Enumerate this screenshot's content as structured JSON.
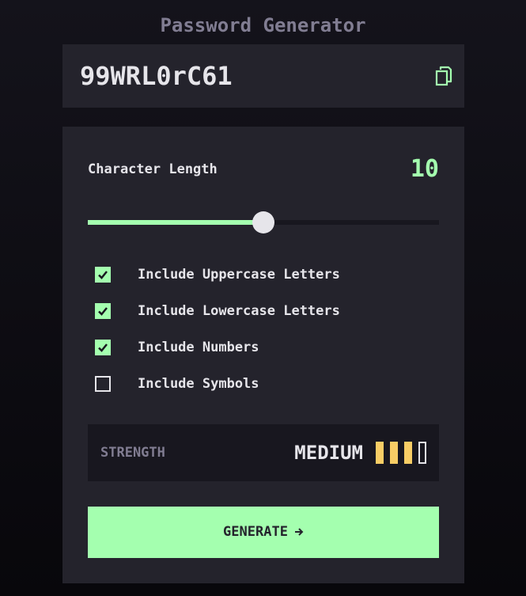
{
  "app": {
    "title": "Password Generator"
  },
  "password": {
    "value": "99WRL0rC61",
    "copy_icon": "copy-icon"
  },
  "length": {
    "label": "Character Length",
    "value": "10",
    "slider_fraction": 0.5
  },
  "options": [
    {
      "label": "Include Uppercase Letters",
      "checked": true
    },
    {
      "label": "Include Lowercase Letters",
      "checked": true
    },
    {
      "label": "Include Numbers",
      "checked": true
    },
    {
      "label": "Include Symbols",
      "checked": false
    }
  ],
  "strength": {
    "label": "STRENGTH",
    "level": "MEDIUM",
    "bars_filled": 3,
    "bars_total": 4
  },
  "generate": {
    "label": "GENERATE",
    "icon": "arrow-right-icon"
  },
  "colors": {
    "accent": "#a4ffaf",
    "medium": "#f8cd65",
    "panel": "#24232c",
    "dark": "#18171f",
    "text": "#e6e5ea",
    "muted": "#817d92"
  }
}
